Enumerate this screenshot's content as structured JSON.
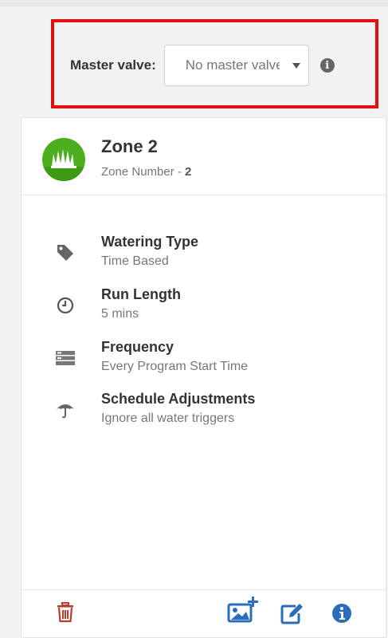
{
  "master_valve": {
    "label": "Master valve:",
    "selected": "No master valve"
  },
  "zone": {
    "title": "Zone 2",
    "subtitle_prefix": "Zone Number - ",
    "number": "2"
  },
  "details": [
    {
      "title": "Watering Type",
      "value": "Time Based",
      "icon": "tag-icon"
    },
    {
      "title": "Run Length",
      "value": "5 mins",
      "icon": "clock-icon"
    },
    {
      "title": "Frequency",
      "value": "Every Program Start Time",
      "icon": "calendar-list-icon"
    },
    {
      "title": "Schedule Adjustments",
      "value": "Ignore all water triggers",
      "icon": "umbrella-icon"
    }
  ],
  "colors": {
    "highlight": "#e01010",
    "zone_green": "#4cae1e",
    "delete_red": "#c0392b",
    "action_blue": "#2a6ebb"
  },
  "footer": {
    "icons": [
      "trash-icon",
      "add-image-icon",
      "edit-icon",
      "info-icon"
    ]
  }
}
